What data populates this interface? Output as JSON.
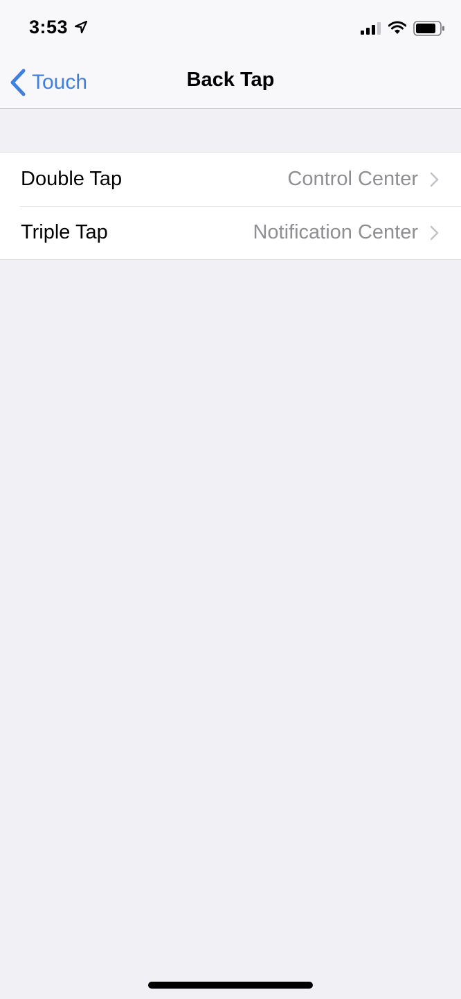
{
  "status_bar": {
    "time": "3:53",
    "icons": [
      "location-arrow-icon",
      "cellular-signal-icon",
      "wifi-icon",
      "battery-icon"
    ]
  },
  "nav": {
    "back_label": "Touch",
    "title": "Back Tap",
    "accent_color": "#3e7fe0"
  },
  "settings": {
    "rows": [
      {
        "label": "Double Tap",
        "value": "Control Center"
      },
      {
        "label": "Triple Tap",
        "value": "Notification Center"
      }
    ]
  },
  "colors": {
    "background": "#f0f0f5",
    "secondary_text": "#8e8e93"
  }
}
